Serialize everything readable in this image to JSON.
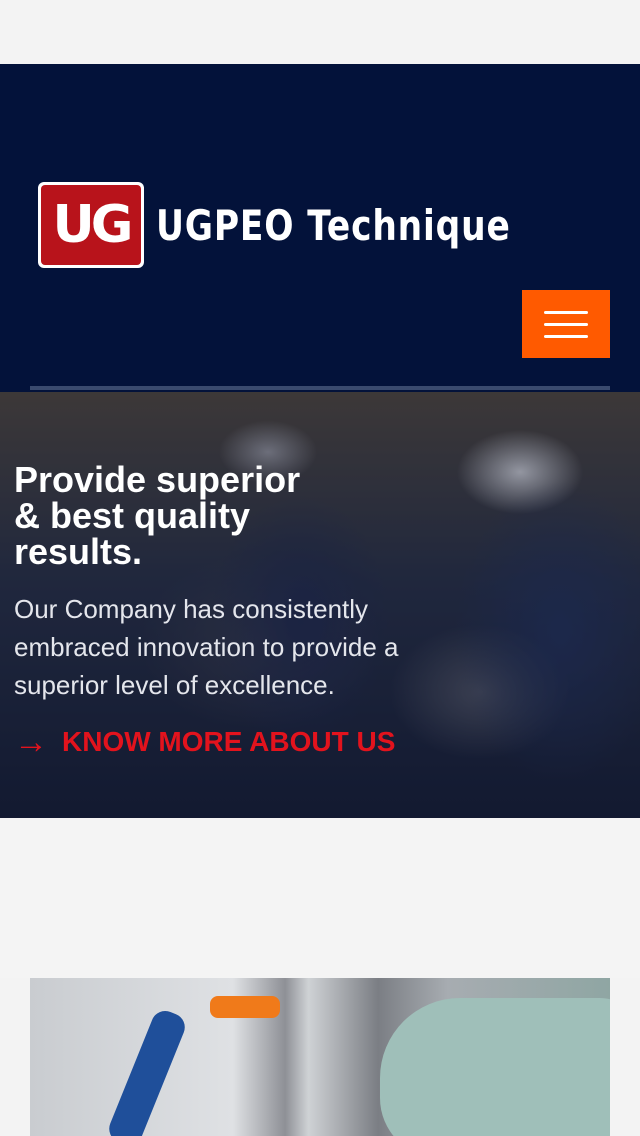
{
  "header": {
    "logo_mark": "UG",
    "logo_text": "UGPEO Technique",
    "menu_icon": "hamburger-menu-icon"
  },
  "hero": {
    "title": "Provide superior & best quality results.",
    "description": "Our Company has consistently embraced innovation to provide a superior level of excellence.",
    "cta_label": "KNOW MORE ABOUT US",
    "cta_icon": "arrow-right-icon"
  },
  "colors": {
    "header_bg": "#03123a",
    "menu_button_bg": "#ff5a00",
    "cta_red": "#e2131d",
    "logo_red": "#b8131b"
  }
}
